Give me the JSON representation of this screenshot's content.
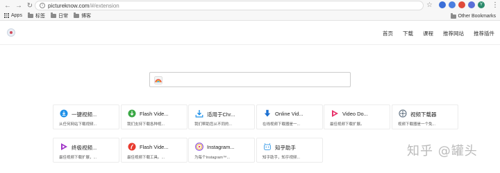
{
  "browser": {
    "url_host": "pictureknow.com",
    "url_path": "/#/extension",
    "profile_initial": "Y"
  },
  "bookmarks": {
    "items": [
      {
        "label": "Apps",
        "icon": "apps-grid-icon"
      },
      {
        "label": "标签",
        "icon": "folder-icon"
      },
      {
        "label": "日常",
        "icon": "folder-icon"
      },
      {
        "label": "博客",
        "icon": "folder-icon"
      }
    ],
    "other": "Other Bookmarks"
  },
  "nav": {
    "items": [
      "首页",
      "下载",
      "课程",
      "推荐网站",
      "推荐插件"
    ]
  },
  "search": {
    "placeholder": ""
  },
  "cards": [
    {
      "title": "一键视频...",
      "desc": "从任何网站下载视频...",
      "icon": "download-circle-icon",
      "color": "#1e90e8"
    },
    {
      "title": "Flash Vide...",
      "desc": "我们支持下载各种视...",
      "icon": "download-arrow-green-icon",
      "color": "#3aa845"
    },
    {
      "title": "适用于Chr...",
      "desc": "我们帮助您从不同的...",
      "icon": "download-tray-icon",
      "color": "#1e90e8"
    },
    {
      "title": "Online Vid...",
      "desc": "在线视频下载器是一...",
      "icon": "download-arrow-blue-icon",
      "color": "#1a6fd1"
    },
    {
      "title": "Video Do...",
      "desc": "最佳视频下载扩展。",
      "icon": "play-triangle-icon",
      "color": "#e8336b"
    },
    {
      "title": "视频下载器",
      "desc": "视频下载器是一个免...",
      "icon": "film-reel-icon",
      "color": "#6b7a8a"
    },
    {
      "title": "终极视频...",
      "desc": "最佳视频下载扩展，...",
      "icon": "play-triangle-purple-icon",
      "color": "#a035c8"
    },
    {
      "title": "Flash Vide...",
      "desc": "最佳视频下载工具。...",
      "icon": "flash-red-icon",
      "color": "#e83a2e"
    },
    {
      "title": "Instagram...",
      "desc": "为每个Instagram™...",
      "icon": "instagram-play-icon",
      "color": "#8b4fd8"
    },
    {
      "title": "知乎助手",
      "desc": "知乎助手，知乎视频...",
      "icon": "robot-helper-icon",
      "color": "#4aa3e8"
    }
  ],
  "watermark": "知乎 @罐头"
}
